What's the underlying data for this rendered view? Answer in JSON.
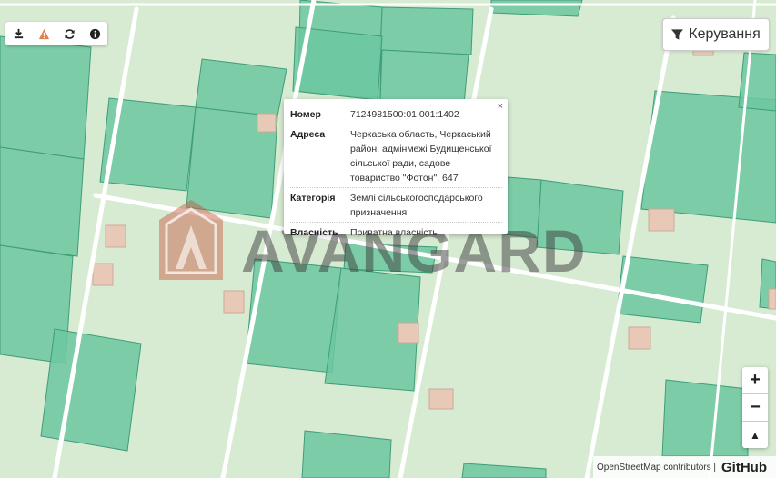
{
  "toolbar": {
    "buttons": [
      {
        "icon": "download-icon"
      },
      {
        "icon": "warning-icon"
      },
      {
        "icon": "refresh-icon"
      },
      {
        "icon": "info-icon"
      }
    ]
  },
  "manage_button": {
    "label": "Керування",
    "icon": "filter-icon"
  },
  "popup": {
    "close": "×",
    "rows": [
      {
        "label": "Номер",
        "value": "7124981500:01:001:1402"
      },
      {
        "label": "Адреса",
        "value": "Черкаська область, Черкаський район, адмінмежі Будищенської сільської ради, садове товариство \"Фотон\", 647"
      },
      {
        "label": "Категорія",
        "value": "Землі сільськогосподарського призначення"
      },
      {
        "label": "Власність",
        "value": "Приватна власність"
      }
    ]
  },
  "zoom": {
    "in": "+",
    "out": "−",
    "north": "▲"
  },
  "attribution": {
    "text": "OpenStreetMap contributors |",
    "brand": "GitHub"
  },
  "watermark": {
    "text": "AVANGARD"
  },
  "colors": {
    "background": "#d7ebd2",
    "parcel_fill": "#6cc7a0",
    "parcel_stroke": "#4aa882",
    "road": "#ffffff",
    "building": "#e8c9b8",
    "watermark_icon": "#c8553d"
  }
}
